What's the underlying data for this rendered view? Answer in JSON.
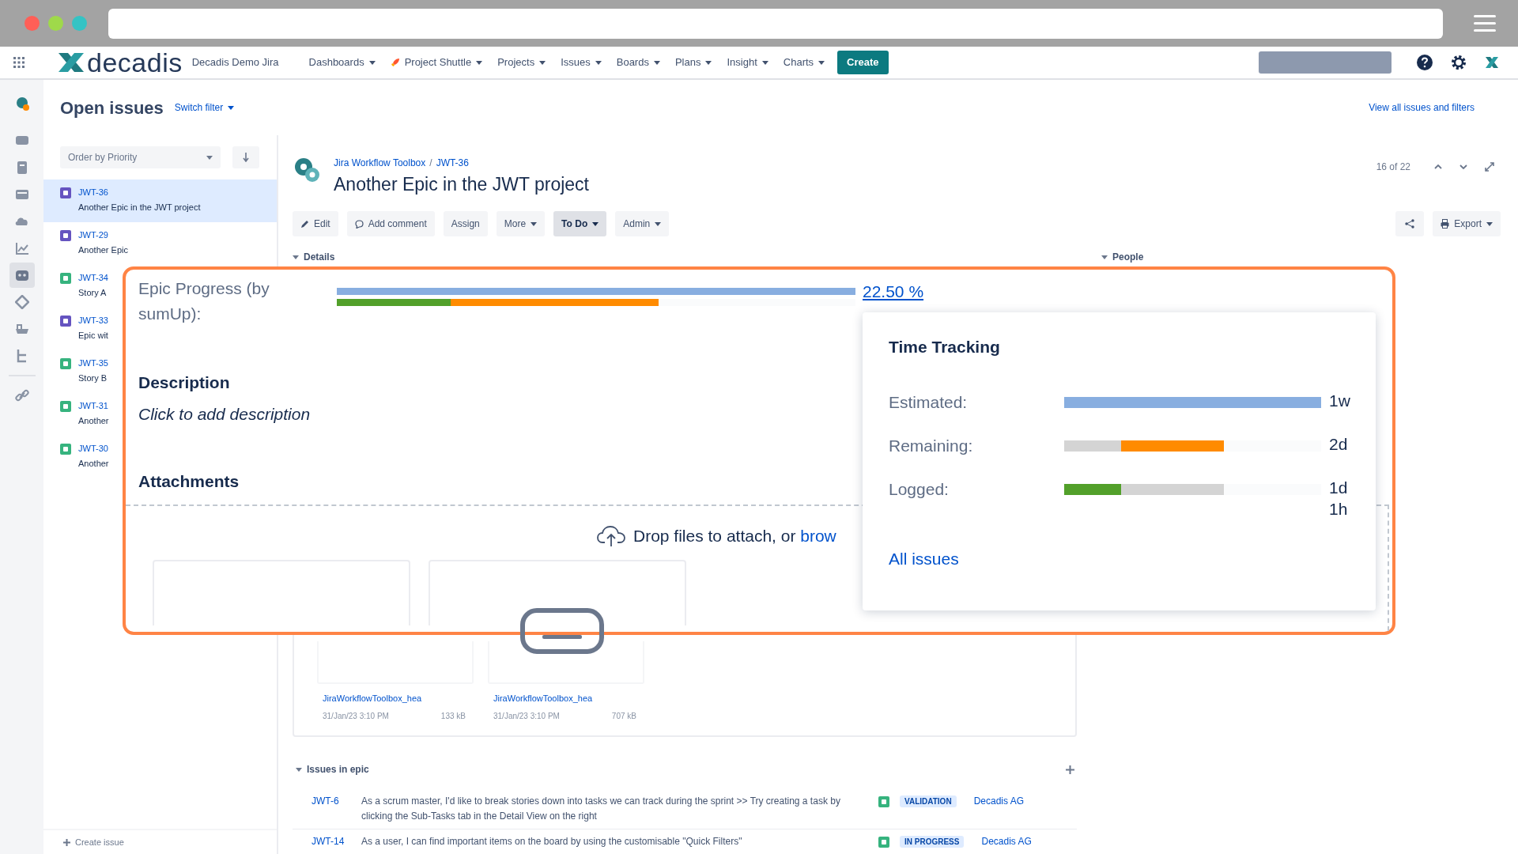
{
  "browser": {
    "controls": [
      {
        "color": "#ff5f57"
      },
      {
        "color": "#9fd94a"
      },
      {
        "color": "#34c3c4"
      }
    ]
  },
  "header": {
    "logo": "decadis",
    "site": "Decadis Demo Jira",
    "nav": [
      {
        "label": "Dashboards",
        "kind": "plain"
      },
      {
        "label": "Project Shuttle",
        "kind": "rocket"
      },
      {
        "label": "Projects",
        "kind": "plain"
      },
      {
        "label": "Issues",
        "kind": "plain"
      },
      {
        "label": "Boards",
        "kind": "plain"
      },
      {
        "label": "Plans",
        "kind": "plain"
      },
      {
        "label": "Insight",
        "kind": "plain"
      },
      {
        "label": "Charts",
        "kind": "plain"
      }
    ],
    "create": "Create"
  },
  "sidebar": {
    "items": [
      {
        "kind": "avatar",
        "selected": false
      },
      {
        "kind": "chat",
        "selected": false
      },
      {
        "kind": "docs",
        "selected": false
      },
      {
        "kind": "board",
        "selected": false
      },
      {
        "kind": "cloud",
        "selected": false
      },
      {
        "kind": "chart",
        "selected": false
      },
      {
        "kind": "robot",
        "selected": true
      },
      {
        "kind": "tag",
        "selected": false
      },
      {
        "kind": "boat",
        "selected": false
      },
      {
        "kind": "tree",
        "selected": false
      },
      {
        "kind": "link",
        "selected": false
      }
    ]
  },
  "issue_list": {
    "title": "Open issues",
    "switch_filter": "Switch filter",
    "view_all": "View all issues and filters",
    "order": "Order by Priority",
    "items": [
      {
        "key": "JWT-36",
        "summary": "Another Epic in the JWT project",
        "color": "#6554c0",
        "selected": true
      },
      {
        "key": "JWT-29",
        "summary": "Another Epic",
        "color": "#6554c0",
        "selected": false
      },
      {
        "key": "JWT-34",
        "summary": "Story A",
        "color": "#36b37e",
        "selected": false
      },
      {
        "key": "JWT-33",
        "summary": "Epic wit",
        "color": "#6554c0",
        "selected": false
      },
      {
        "key": "JWT-35",
        "summary": "Story B",
        "color": "#36b37e",
        "selected": false
      },
      {
        "key": "JWT-31",
        "summary": "Another",
        "color": "#36b37e",
        "selected": false
      },
      {
        "key": "JWT-30",
        "summary": "Another",
        "color": "#36b37e",
        "selected": false
      }
    ],
    "create": "Create issue"
  },
  "issue": {
    "breadcrumb": {
      "items": [
        "Jira Workflow Toolbox",
        "JWT-36"
      ],
      "separator": "/"
    },
    "title": "Another Epic in the JWT project",
    "pager": "16 of 22",
    "toolbar": [
      {
        "label": "Edit",
        "kind": "edit"
      },
      {
        "label": "Add comment",
        "kind": "comment"
      },
      {
        "label": "Assign",
        "kind": "plain"
      },
      {
        "label": "More",
        "kind": "dropdown"
      },
      {
        "label": "To Do",
        "kind": "status"
      },
      {
        "label": "Admin",
        "kind": "dropdown"
      }
    ],
    "export": "Export",
    "details": "Details",
    "people": "People",
    "attachments": [
      {
        "name": "JiraWorkflowToolbox_hea",
        "date": "31/Jan/23 3:10 PM",
        "size": "133 kB"
      },
      {
        "name": "JiraWorkflowToolbox_hea",
        "date": "31/Jan/23 3:10 PM",
        "size": "707 kB"
      }
    ],
    "issues_in_epic": {
      "title": "Issues in epic",
      "rows": [
        {
          "key": "JWT-6",
          "summary": "As a scrum master, I'd like to break stories down into tasks we can track during the sprint >> Try creating a task by clicking the Sub-Tasks tab in the Detail View on the right",
          "status": "VALIDATION",
          "assignee": "Decadis AG"
        },
        {
          "key": "JWT-14",
          "summary": "As a user, I can find important items on the board by using the customisable \"Quick Filters\"",
          "status": "IN PROGRESS",
          "assignee": "Decadis AG"
        }
      ]
    }
  },
  "callout": {
    "epic_progress": {
      "label": "Epic Progress (by sumUp):",
      "total": {
        "level": 1
      },
      "segments": [
        {
          "kind": "done",
          "level": 0.22
        },
        {
          "kind": "in_progress",
          "level": 0.4
        }
      ],
      "percent": "22.50 %"
    },
    "description": {
      "heading": "Description",
      "prompt": "Click to add description"
    },
    "attachments": {
      "heading": "Attachments",
      "drop_text": "Drop files to attach, or",
      "browse": "brow"
    },
    "time_tracking": {
      "title": "Time Tracking",
      "rows": [
        {
          "label": "Estimated:",
          "kind": "estimated",
          "level": 1,
          "value": "1w"
        },
        {
          "label": "Remaining:",
          "kind": "remaining",
          "level": 0.4,
          "value": "2d"
        },
        {
          "label": "Logged:",
          "kind": "logged",
          "level": 0.22,
          "value": "1d 1h"
        }
      ],
      "link": "All issues"
    }
  }
}
